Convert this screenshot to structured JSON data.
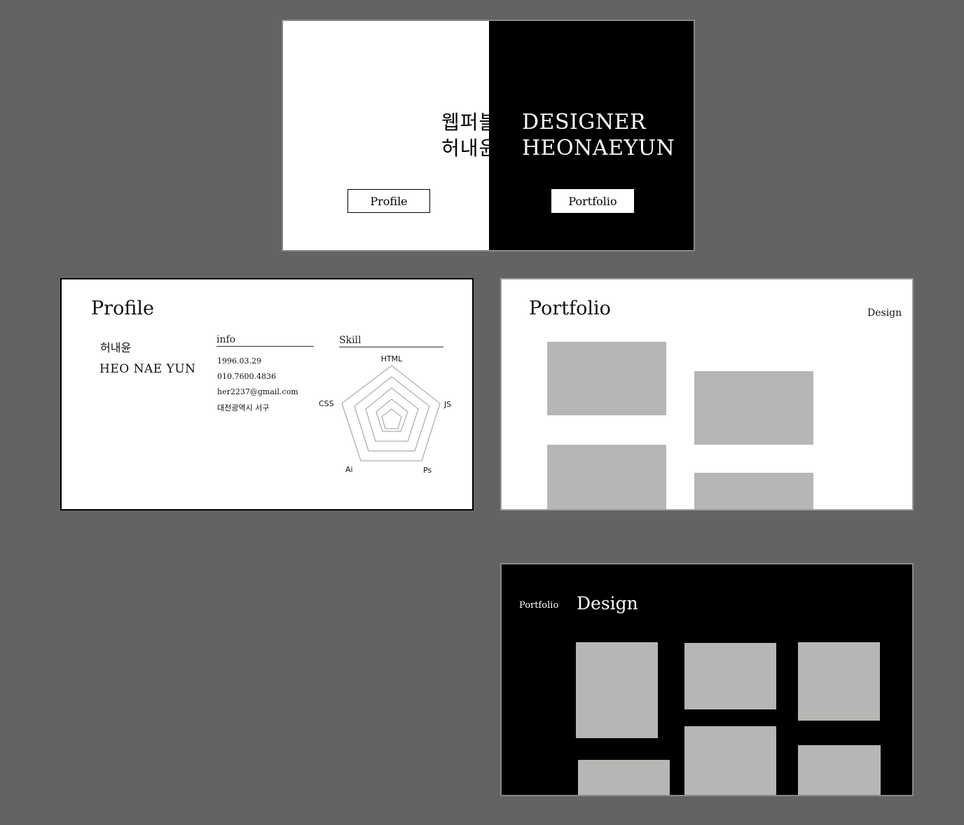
{
  "intro": {
    "kr_title_line1": "웹퍼블",
    "kr_title_line2": "허내윤",
    "en_title_line1": "DESIGNER",
    "en_title_line2": "HEONAEYUN",
    "profile_button": "Profile",
    "portfolio_button": "Portfolio"
  },
  "profile": {
    "title": "Profile",
    "name_kr": "허내윤",
    "name_en": "HEO NAE YUN",
    "info_heading": "info",
    "info": [
      "1996.03.29",
      "010.7600.4836",
      "her2237@gmail.com",
      "대전광역시 서구"
    ],
    "skill_heading": "Skill",
    "skills": [
      "HTML",
      "JS",
      "Ps",
      "Ai",
      "CSS"
    ]
  },
  "portfolio": {
    "title": "Portfolio",
    "nav_design": "Design"
  },
  "design": {
    "nav_portfolio": "Portfolio",
    "title": "Design"
  },
  "colors": {
    "background": "#636363",
    "thumbnail": "#b7b6b4",
    "black": "#000000",
    "white": "#ffffff"
  }
}
